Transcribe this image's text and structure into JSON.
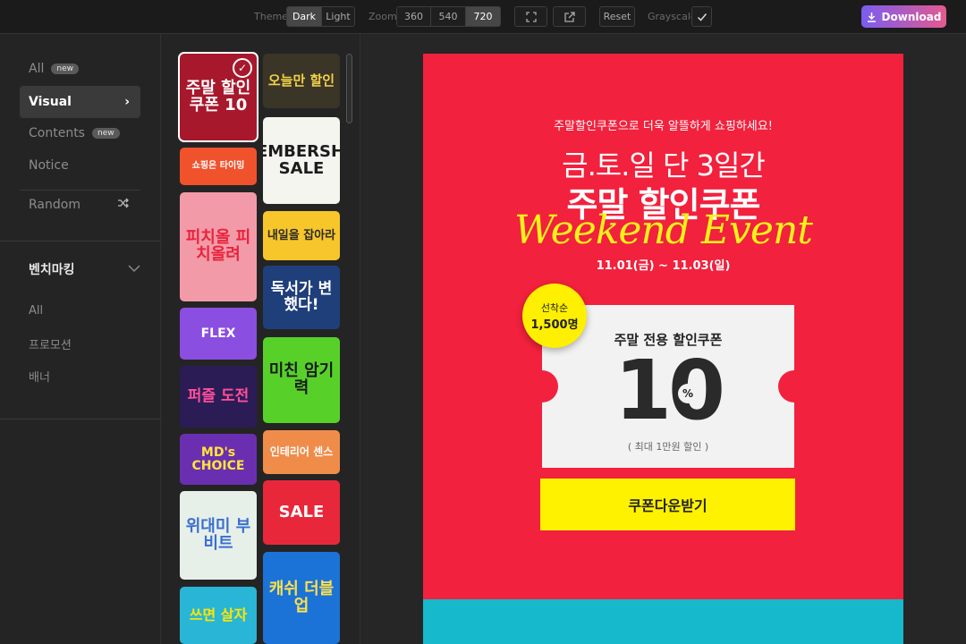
{
  "toolbar": {
    "theme_label": "Theme",
    "theme_options": [
      "Dark",
      "Light"
    ],
    "zoom_label": "Zoom",
    "zoom_options": [
      "360",
      "540",
      "720"
    ],
    "reset_label": "Reset",
    "grayscale_label": "Grayscale",
    "download_label": "Download"
  },
  "sidebar": {
    "items": [
      {
        "label": "All",
        "badge": "new"
      },
      {
        "label": "Visual",
        "badge": ""
      },
      {
        "label": "Contents",
        "badge": "new"
      },
      {
        "label": "Notice",
        "badge": ""
      },
      {
        "label": "Random",
        "badge": ""
      }
    ],
    "section_title": "벤치마킹",
    "sub_items": [
      "All",
      "프로모션",
      "배너"
    ]
  },
  "thumbnails": [
    {
      "text": "주말 할인쿠폰 10",
      "bg": "#a8182c",
      "fg": "#ffffff"
    },
    {
      "text": "쇼핑은 타이밍",
      "bg": "#f0522c",
      "fg": "#ffffff"
    },
    {
      "text": "피치올 피치올려",
      "bg": "#f39aa9",
      "fg": "#e8233a"
    },
    {
      "text": "FLEX",
      "bg": "#8a4ee0",
      "fg": "#ffffff"
    },
    {
      "text": "퍼즐 도전",
      "bg": "#2b1c56",
      "fg": "#ff4f9a"
    },
    {
      "text": "MD's CHOICE",
      "bg": "#6a2fb0",
      "fg": "#ffe53a"
    },
    {
      "text": "위대미 부비트",
      "bg": "#e7efe9",
      "fg": "#3a6fd0"
    },
    {
      "text": "쓰면 살자",
      "bg": "#29b6d6",
      "fg": "#ffe600"
    },
    {
      "text": "오늘만 할인",
      "bg": "#3a3526",
      "fg": "#f2d24a"
    },
    {
      "text": "MEMBERSHIP SALE",
      "bg": "#f5f5f0",
      "fg": "#1c1c1c"
    },
    {
      "text": "내일을 잡아라",
      "bg": "#f7c62a",
      "fg": "#2a2a2a"
    },
    {
      "text": "독서가 변했다!",
      "bg": "#1f3f7a",
      "fg": "#ffffff"
    },
    {
      "text": "미친 암기력",
      "bg": "#57d12a",
      "fg": "#1a1a1a"
    },
    {
      "text": "인테리어 센스",
      "bg": "#f08c4a",
      "fg": "#ffffff"
    },
    {
      "text": "SALE",
      "bg": "#e8283a",
      "fg": "#ffffff"
    },
    {
      "text": "캐쉬 더블업",
      "bg": "#1b73d8",
      "fg": "#ffe14a"
    }
  ],
  "poster": {
    "subtitle": "주말할인쿠폰으로 더욱 알뜰하게 쇼핑하세요!",
    "headline_1": "금.토.일 단 3일간",
    "headline_2": "주말 할인쿠폰",
    "script": "Weekend Event",
    "date": "11.01(금) ~ 11.03(일)",
    "badge_line_1": "선착순",
    "badge_line_2": "1,500명",
    "coupon_label": "주말 전용 할인쿠폰",
    "coupon_value": "10",
    "coupon_unit": "%",
    "coupon_note": "( 최대 1만원 할인 )",
    "cta_label": "쿠폰다운받기",
    "colors": {
      "background": "#f2213d",
      "accent": "#fff200",
      "footer": "#16b8cc"
    }
  }
}
